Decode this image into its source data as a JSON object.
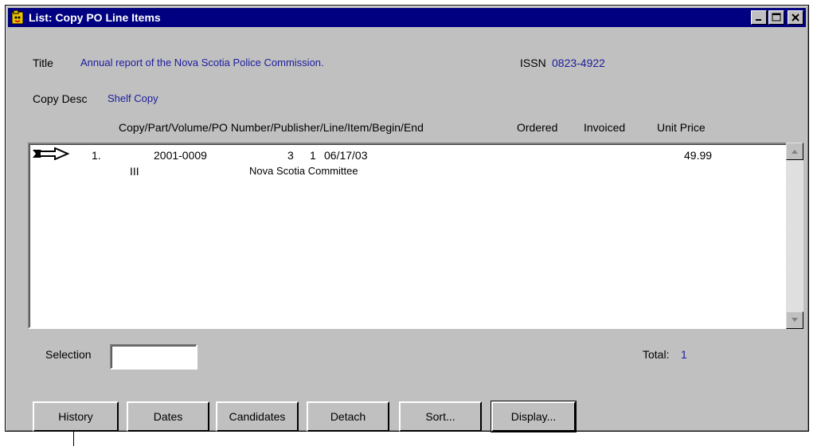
{
  "window": {
    "title": "List: Copy  PO Line Items",
    "icon": "folder-app-icon"
  },
  "header": {
    "title_label": "Title",
    "title_value": "Annual report of the Nova Scotia Police Commission.",
    "issn_label": "ISSN",
    "issn_value": "0823-4922",
    "copy_desc_label": "Copy Desc",
    "copy_desc_value": "Shelf Copy"
  },
  "columns": {
    "main": "Copy/Part/Volume/PO Number/Publisher/Line/Item/Begin/End",
    "ordered": "Ordered",
    "invoiced": "Invoiced",
    "unit_price": "Unit Price"
  },
  "rows": [
    {
      "index": "1.",
      "po_number": "2001-0009",
      "line": "3",
      "item": "1",
      "begin_date": "06/17/03",
      "unit_price": "49.99",
      "volume": "III",
      "publisher": "Nova Scotia Committee"
    }
  ],
  "footer": {
    "selection_label": "Selection",
    "selection_value": "",
    "total_label": "Total:",
    "total_value": "1"
  },
  "buttons": {
    "history": "History",
    "dates": "Dates",
    "candidates": "Candidates",
    "detach": "Detach",
    "sort": "Sort...",
    "display": "Display..."
  },
  "colors": {
    "titlebar": "#000080",
    "value_text": "#1c1c9c",
    "window_bg": "#c0c0c0"
  }
}
